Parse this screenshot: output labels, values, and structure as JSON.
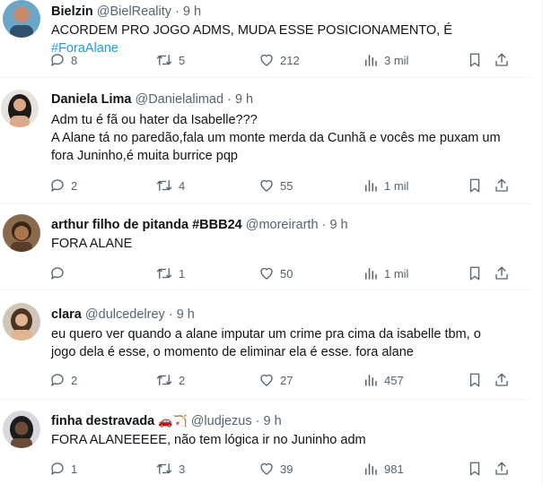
{
  "tweets": [
    {
      "name": "Bielzin",
      "handle": "@BielReality",
      "time": "9 h",
      "lines": [
        "ACORDEM PRO JOGO ADMS, MUDA ESSE POSICIONAMENTO, É "
      ],
      "hashtag": "#ForaAlane",
      "replies": "8",
      "retweets": "5",
      "likes": "212",
      "views": "3 mil"
    },
    {
      "name": "Daniela Lima",
      "handle": "@Danielalimad",
      "time": "9 h",
      "lines": [
        "Adm tu é fã ou hater da Isabelle???",
        "A Alane tá no paredão,fala um monte merda da Cunhã e vocês me puxam um",
        "fora Juninho,é muita burrice pqp"
      ],
      "replies": "2",
      "retweets": "4",
      "likes": "55",
      "views": "1 mil"
    },
    {
      "name": "arthur filho de pitanda #BBB24",
      "handle": "@moreirarth",
      "time": "9 h",
      "lines": [
        "FORA ALANE"
      ],
      "replies": "",
      "retweets": "1",
      "likes": "50",
      "views": "1 mil"
    },
    {
      "name": "clara",
      "handle": "@dulcedelrey",
      "time": "9 h",
      "lines": [
        "eu quero ver quando a alane imputar um crime pra cima da isabelle tbm, o",
        "jogo dela é esse, o momento de eliminar ela é esse. fora alane"
      ],
      "replies": "2",
      "retweets": "2",
      "likes": "27",
      "views": "457"
    },
    {
      "name": "finha destravada",
      "name_emoji": "🚗🏹",
      "handle": "@ludjezus",
      "time": "9 h",
      "lines": [
        "FORA ALANEEEEE, não tem lógica ir no Juninho adm"
      ],
      "replies": "1",
      "retweets": "3",
      "likes": "39",
      "views": "981"
    }
  ],
  "separator": "·",
  "icons": {
    "reply": "reply-icon",
    "retweet": "retweet-icon",
    "like": "heart-icon",
    "views": "analytics-icon",
    "bookmark": "bookmark-icon",
    "share": "share-icon"
  },
  "colors": {
    "text": "#0f1419",
    "secondary": "#536471",
    "link": "#1d9bf0",
    "border": "#eff3f4"
  }
}
